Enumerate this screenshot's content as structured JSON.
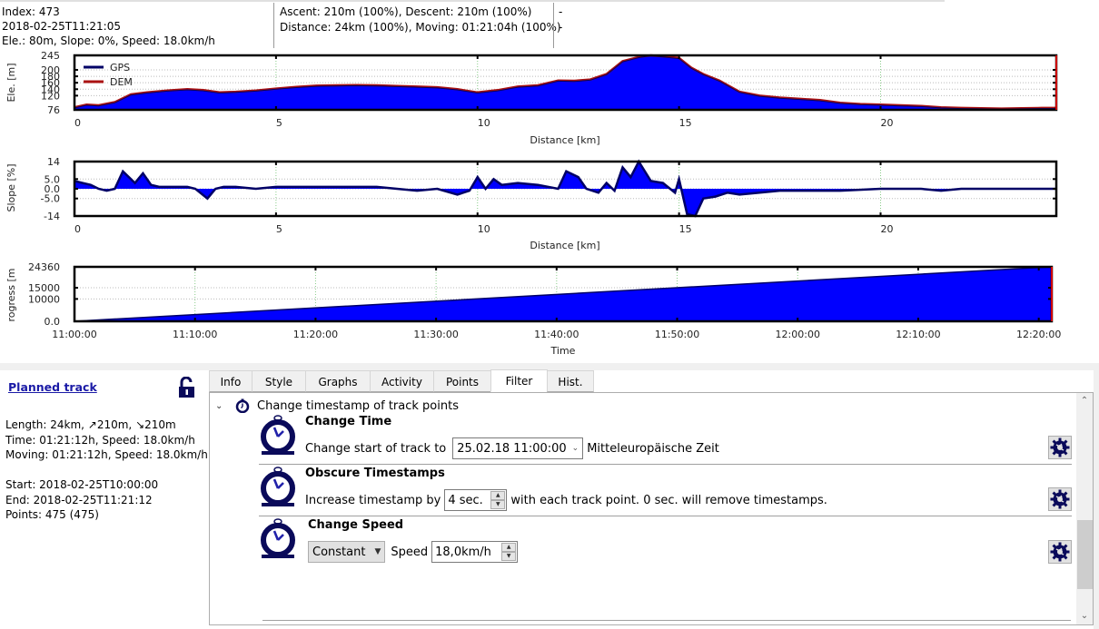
{
  "status": {
    "index": "Index: 473",
    "timestamp": "2018-02-25T11:21:05",
    "point_values": "Ele.: 80m, Slope: 0%, Speed: 18.0km/h",
    "ascent_descent": "Ascent: 210m (100%), Descent: 210m (100%)",
    "distance_moving": "Distance: 24km (100%), Moving: 01:21:04h (100%)",
    "extra1": "-",
    "extra2": "-"
  },
  "colors": {
    "fill": "#0000ff",
    "gps_line": "#000066",
    "dem_line": "#aa1111",
    "link": "#1a1aa6",
    "icon": "#0a0a5a"
  },
  "chart_data": [
    {
      "type": "area",
      "name": "elevation",
      "ylabel": "Ele. [m]",
      "xlabel": "Distance [km]",
      "xlim": [
        0,
        24.36
      ],
      "ylim": [
        76,
        245
      ],
      "yticks": [
        "245",
        "200",
        "180",
        "160",
        "140",
        "120",
        "76"
      ],
      "ytick_values": [
        245,
        200,
        180,
        160,
        140,
        120,
        76
      ],
      "xticks": [
        "0",
        "5",
        "10",
        "15",
        "20"
      ],
      "xtick_values": [
        0,
        5,
        10,
        15,
        20
      ],
      "grid": true,
      "legend": {
        "position": "top-left",
        "entries": [
          "GPS",
          "DEM"
        ]
      },
      "x": [
        0,
        0.3,
        0.6,
        1.0,
        1.4,
        1.8,
        2.3,
        2.8,
        3.2,
        3.6,
        4.0,
        4.5,
        5.0,
        5.5,
        6.0,
        6.5,
        7.0,
        7.5,
        8.0,
        8.5,
        9.0,
        9.5,
        10.0,
        10.5,
        11.0,
        11.5,
        12.0,
        12.4,
        12.8,
        13.2,
        13.6,
        14.0,
        14.3,
        14.6,
        15.0,
        15.3,
        15.6,
        16.0,
        16.5,
        17.0,
        17.5,
        18.0,
        18.5,
        19.0,
        19.5,
        20.0,
        20.5,
        21.0,
        21.5,
        22.0,
        22.5,
        23.0,
        23.5,
        24.0,
        24.36
      ],
      "series": [
        {
          "name": "GPS",
          "values": [
            82,
            90,
            88,
            98,
            122,
            128,
            134,
            138,
            135,
            128,
            130,
            134,
            140,
            145,
            149,
            150,
            151,
            150,
            148,
            146,
            144,
            138,
            128,
            135,
            146,
            150,
            165,
            164,
            168,
            185,
            225,
            238,
            244,
            240,
            235,
            205,
            185,
            165,
            130,
            118,
            112,
            108,
            104,
            96,
            92,
            90,
            88,
            86,
            82,
            80,
            79,
            78,
            79,
            80,
            80
          ]
        },
        {
          "name": "DEM",
          "values": [
            84,
            92,
            90,
            100,
            124,
            130,
            136,
            140,
            137,
            130,
            132,
            136,
            142,
            147,
            151,
            152,
            153,
            152,
            150,
            148,
            146,
            140,
            130,
            137,
            148,
            152,
            167,
            166,
            170,
            187,
            227,
            240,
            245,
            242,
            237,
            207,
            187,
            167,
            132,
            120,
            114,
            110,
            106,
            98,
            94,
            92,
            90,
            88,
            84,
            82,
            81,
            80,
            81,
            82,
            82
          ]
        }
      ]
    },
    {
      "type": "area",
      "name": "slope",
      "ylabel": "Slope [%]",
      "xlabel": "Distance [km]",
      "xlim": [
        0,
        24.36
      ],
      "ylim": [
        -14,
        14
      ],
      "yticks": [
        "14",
        "5.0",
        "0.0",
        "-5.0",
        "-14"
      ],
      "ytick_values": [
        14,
        5,
        0,
        -5,
        -14
      ],
      "xticks": [
        "0",
        "5",
        "10",
        "15",
        "20"
      ],
      "xtick_values": [
        0,
        5,
        10,
        15,
        20
      ],
      "grid": true,
      "x": [
        0,
        0.2,
        0.4,
        0.6,
        0.8,
        1.0,
        1.2,
        1.5,
        1.7,
        1.9,
        2.1,
        2.3,
        2.5,
        2.8,
        3.0,
        3.3,
        3.5,
        3.7,
        4.0,
        4.5,
        5.0,
        5.5,
        6.0,
        6.5,
        7.0,
        7.5,
        8.0,
        8.5,
        9.0,
        9.5,
        9.8,
        10.0,
        10.2,
        10.4,
        10.6,
        11.0,
        11.5,
        12.0,
        12.2,
        12.5,
        12.7,
        13.0,
        13.2,
        13.4,
        13.6,
        13.8,
        14.0,
        14.3,
        14.6,
        14.9,
        15.0,
        15.2,
        15.4,
        15.6,
        15.9,
        16.2,
        16.5,
        17.0,
        17.5,
        18.0,
        19.0,
        20.0,
        21.0,
        21.5,
        22.0,
        23.0,
        24.0,
        24.36
      ],
      "values": [
        4,
        3,
        2,
        0,
        -1,
        0,
        9,
        3,
        8,
        2,
        1,
        1,
        1,
        1,
        0,
        -5,
        0,
        1,
        1,
        0,
        1,
        1,
        1,
        1,
        1,
        1,
        0,
        -1,
        0,
        -3,
        -1,
        6,
        0,
        5,
        2,
        3,
        2,
        0,
        9,
        6,
        0,
        -2,
        3,
        -1,
        11,
        6,
        14,
        4,
        3,
        -2,
        5,
        -13,
        -14,
        -5,
        -4,
        -2,
        -3,
        -2,
        -1,
        -1,
        -1,
        0,
        0,
        -1,
        0,
        0,
        0,
        0
      ]
    },
    {
      "type": "area",
      "name": "progress",
      "ylabel": "Progress [m]",
      "xlabel": "Time",
      "xlim": [
        "11:00:00",
        "12:21:05"
      ],
      "ylim": [
        0,
        24360
      ],
      "yticks": [
        "24360",
        "15000",
        "10000",
        "0.0"
      ],
      "ytick_values": [
        24360,
        15000,
        10000,
        0
      ],
      "xticks": [
        "11:00:00",
        "11:10:00",
        "11:20:00",
        "11:30:00",
        "11:40:00",
        "11:50:00",
        "12:00:00",
        "12:10:00",
        "12:20:00"
      ],
      "xtick_minutes": [
        0,
        10,
        20,
        30,
        40,
        50,
        60,
        70,
        80
      ],
      "grid": true,
      "x_minutes": [
        0,
        81.08
      ],
      "values": [
        0,
        24360
      ]
    }
  ],
  "track": {
    "title": "Planned track",
    "stats": "Length: 24km, ↗210m, ↘210m\nTime: 01:21:12h, Speed: 18.0km/h\nMoving: 01:21:12h, Speed: 18.0km/h\n\nStart: 2018-02-25T10:00:00\nEnd: 2018-02-25T11:21:12\nPoints: 475 (475)"
  },
  "tabs": [
    {
      "label": "Info"
    },
    {
      "label": "Style"
    },
    {
      "label": "Graphs"
    },
    {
      "label": "Activity"
    },
    {
      "label": "Points"
    },
    {
      "label": "Filter",
      "active": true
    },
    {
      "label": "Hist."
    }
  ],
  "filter": {
    "group_title": "Change timestamp of track points",
    "items": [
      {
        "title": "Change Time",
        "label_before": "Change start of track to",
        "datetime_value": "25.02.18 11:00:00",
        "label_after": "Mitteleuropäische Zeit"
      },
      {
        "title": "Obscure Timestamps",
        "label_before": "Increase timestamp by",
        "spin_value": "4 sec.",
        "label_after": "with each track point. 0 sec. will remove timestamps."
      },
      {
        "title": "Change Speed",
        "mode_value": "Constant",
        "speed_label": "Speed",
        "speed_value": "18,0km/h"
      }
    ]
  }
}
